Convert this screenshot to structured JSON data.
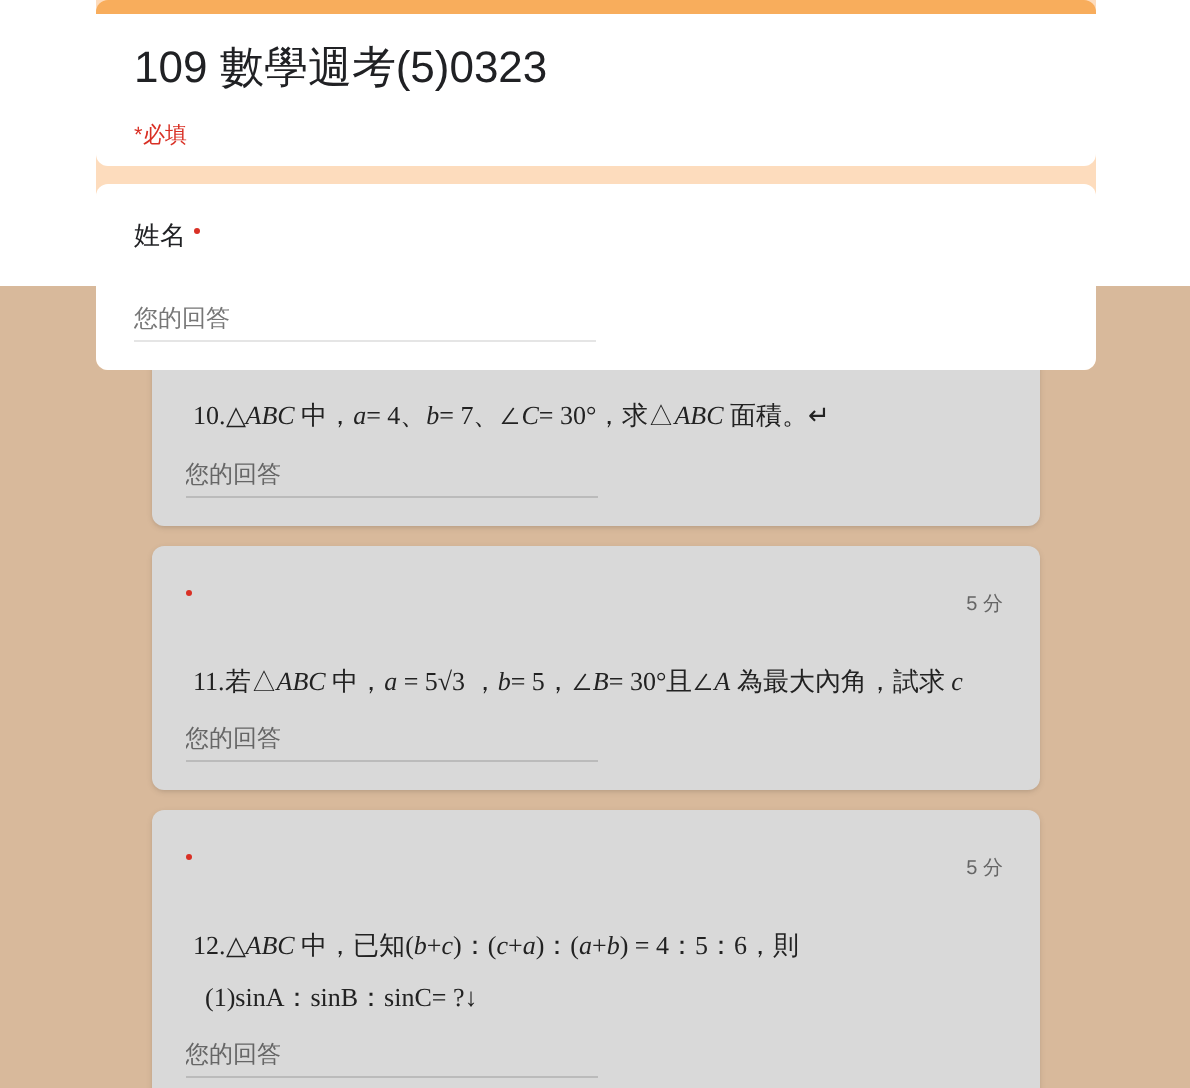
{
  "header": {
    "title": "109 數學週考(5)0323",
    "required_note": "*必填"
  },
  "name_question": {
    "label": "姓名",
    "required": true,
    "placeholder": "您的回答"
  },
  "questions": [
    {
      "lines": [
        "10.△*ABC* 中，*a*= 4、*b*= 7、∠*C*= 30°，求△*ABC* 面積。↵"
      ],
      "placeholder": "您的回答"
    },
    {
      "required": true,
      "points": "5 分",
      "lines": [
        "11.若△*ABC* 中，*a* = 5√3 ，*b*= 5，∠*B*= 30°且∠*A* 為最大內角，試求 *c*"
      ],
      "placeholder": "您的回答"
    },
    {
      "required": true,
      "points": "5 分",
      "lines": [
        "12.△*ABC* 中，已知(*b*+*c*)：(*c*+*a*)：(*a*+*b*) = 4：5：6，則",
        "(1)sinA：sinB：sinC= ?↓"
      ],
      "placeholder": "您的回答"
    }
  ]
}
